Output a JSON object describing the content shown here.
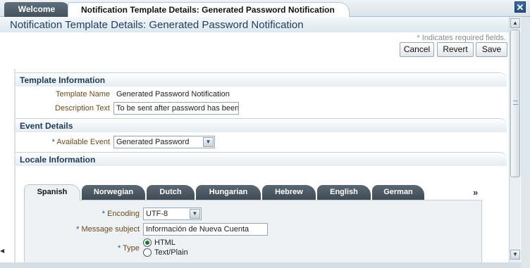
{
  "tabs": {
    "welcome": "Welcome",
    "active": "Notification Template Details: Generated Password Notification",
    "close_icon": "close-icon"
  },
  "page": {
    "title": "Notification Template Details: Generated Password Notification",
    "required_note": "* Indicates required fields."
  },
  "toolbar": {
    "cancel": "Cancel",
    "revert": "Revert",
    "save": "Save"
  },
  "template_info": {
    "header": "Template Information",
    "name_label": "Template Name",
    "name_value": "Generated Password Notification",
    "description_label": "Description Text",
    "description_value": "To be sent after password has been generated"
  },
  "event_details": {
    "header": "Event Details",
    "required_mark": "*",
    "event_label": "Available Event",
    "event_value": "Generated Password"
  },
  "locale_info": {
    "header": "Locale Information",
    "tabs": [
      "Spanish",
      "Norwegian",
      "Dutch",
      "Hungarian",
      "Hebrew",
      "English",
      "German"
    ],
    "more": "»",
    "required_mark": "*",
    "encoding_label": "Encoding",
    "encoding_value": "UTF-8",
    "subject_label": "Message subject",
    "subject_value": "Información de Nueva Cuenta",
    "type_label": "Type",
    "type_options": [
      "HTML",
      "Text/Plain"
    ],
    "type_selected": "HTML"
  }
}
